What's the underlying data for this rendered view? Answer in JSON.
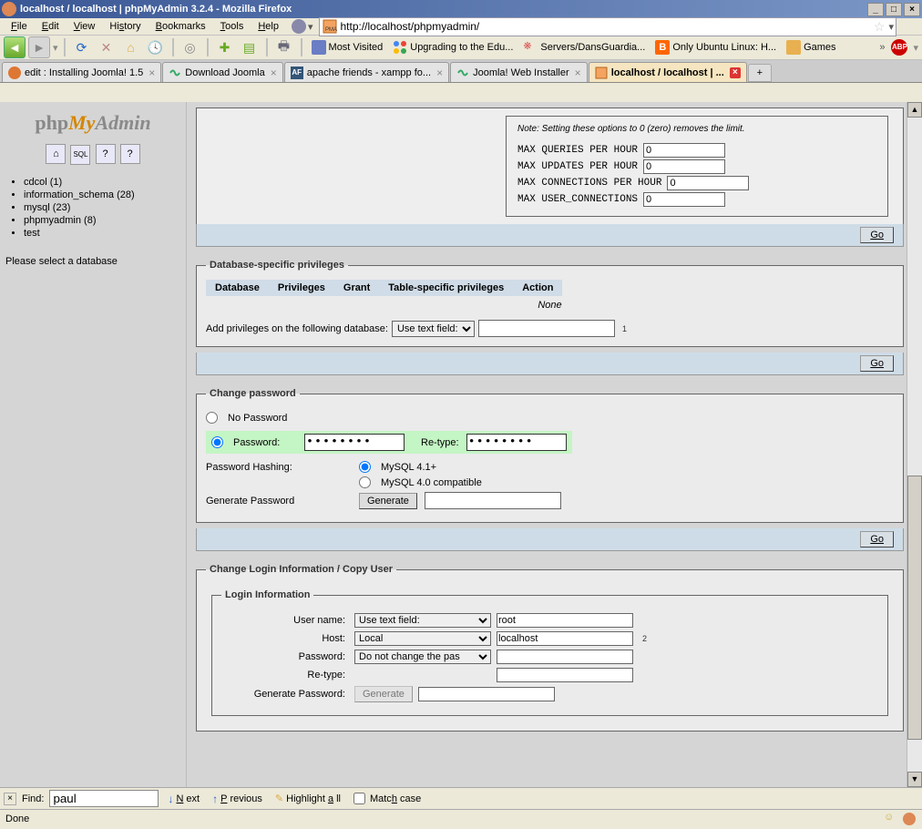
{
  "window": {
    "title": "localhost / localhost | phpMyAdmin 3.2.4 - Mozilla Firefox"
  },
  "menubar": [
    "File",
    "Edit",
    "View",
    "History",
    "Bookmarks",
    "Tools",
    "Help"
  ],
  "url": "http://localhost/phpmyadmin/",
  "bookmarks": [
    {
      "label": "Most Visited"
    },
    {
      "label": "Upgrading to the Edu..."
    },
    {
      "label": "Servers/DansGuardia..."
    },
    {
      "label": "Only Ubuntu Linux: H..."
    },
    {
      "label": "Games"
    }
  ],
  "tabs": [
    {
      "label": "edit : Installing Joomla! 1.5"
    },
    {
      "label": "Download Joomla"
    },
    {
      "label": "apache friends - xampp fo..."
    },
    {
      "label": "Joomla! Web Installer"
    },
    {
      "label": "localhost / localhost | ...",
      "active": true
    }
  ],
  "sidebar": {
    "databases": [
      {
        "name": "cdcol",
        "count": "(1)"
      },
      {
        "name": "information_schema",
        "count": "(28)"
      },
      {
        "name": "mysql",
        "count": "(23)"
      },
      {
        "name": "phpmyadmin",
        "count": "(8)"
      },
      {
        "name": "test",
        "count": ""
      }
    ],
    "select_msg": "Please select a database"
  },
  "limits": {
    "note": "Note: Setting these options to 0 (zero) removes the limit.",
    "rows": [
      {
        "label": "MAX QUERIES PER HOUR",
        "value": "0"
      },
      {
        "label": "MAX UPDATES PER HOUR",
        "value": "0"
      },
      {
        "label": "MAX CONNECTIONS PER HOUR",
        "value": "0"
      },
      {
        "label": "MAX USER_CONNECTIONS",
        "value": "0"
      }
    ]
  },
  "go_label": "Go",
  "db_priv": {
    "legend": "Database-specific privileges",
    "headers": [
      "Database",
      "Privileges",
      "Grant",
      "Table-specific privileges",
      "Action"
    ],
    "none": "None",
    "add_label": "Add privileges on the following database:",
    "select_opt": "Use text field:",
    "sup": "1"
  },
  "change_pw": {
    "legend": "Change password",
    "no_password": "No Password",
    "password": "Password:",
    "retype": "Re-type:",
    "pw_value": "●●●●●●●●",
    "hash_label": "Password Hashing:",
    "hash_41": "MySQL 4.1+",
    "hash_40": "MySQL 4.0 compatible",
    "gen_label": "Generate Password",
    "gen_btn": "Generate"
  },
  "login": {
    "legend": "Change Login Information / Copy User",
    "inner_legend": "Login Information",
    "username_label": "User name:",
    "username_sel": "Use text field:",
    "username_val": "root",
    "host_label": "Host:",
    "host_sel": "Local",
    "host_val": "localhost",
    "host_sup": "2",
    "password_label": "Password:",
    "password_sel": "Do not change the pas",
    "retype_label": "Re-type:",
    "gen_label": "Generate Password:",
    "gen_btn": "Generate"
  },
  "findbar": {
    "label": "Find:",
    "value": "paul",
    "next": "Next",
    "prev": "Previous",
    "highlight": "Highlight all",
    "matchcase": "Match case"
  },
  "statusbar": {
    "text": "Done"
  }
}
